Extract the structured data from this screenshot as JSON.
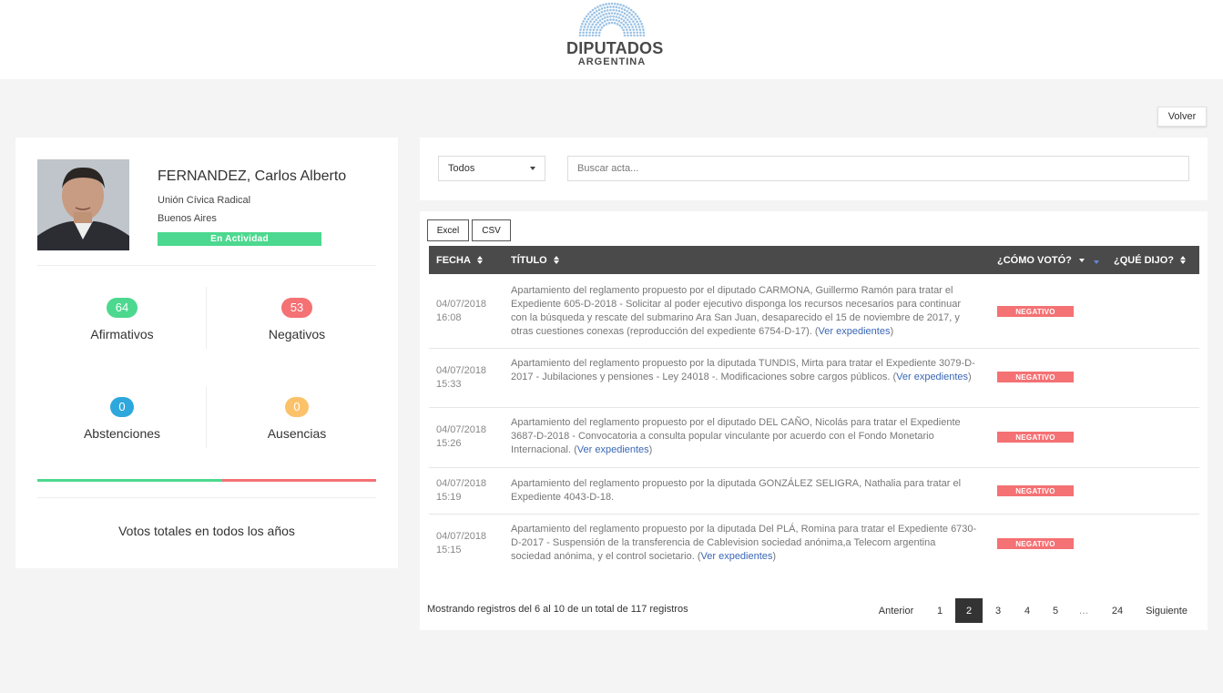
{
  "header": {
    "logo_main": "DIPUTADOS",
    "logo_sub": "ARGENTINA",
    "colors": {
      "logo_blue": "#9cc3e6"
    }
  },
  "back_button": "Volver",
  "profile": {
    "name": "FERNANDEZ, Carlos Alberto",
    "party": "Unión Cívica Radical",
    "district": "Buenos Aires",
    "status": "En Actividad",
    "stats": {
      "afirmativos": {
        "count": "64",
        "label": "Afirmativos",
        "color": "#4cd88f"
      },
      "negativos": {
        "count": "53",
        "label": "Negativos",
        "color": "#f47174"
      },
      "abstenciones": {
        "count": "0",
        "label": "Abstenciones",
        "color": "#2ea8dc"
      },
      "ausencias": {
        "count": "0",
        "label": "Ausencias",
        "color": "#fbc26a"
      }
    },
    "vote_share": {
      "afirmativos": 64,
      "negativos": 53
    },
    "totals_label": "Votos totales en todos los años"
  },
  "filter": {
    "select_value": "Todos",
    "search_placeholder": "Buscar acta..."
  },
  "export": {
    "excel": "Excel",
    "csv": "CSV"
  },
  "table": {
    "columns": {
      "date": "FECHA",
      "title": "TÍTULO",
      "vote": "¿CÓMO VOTÓ?",
      "said": "¿QUÉ DIJO?"
    },
    "link_text": "Ver expedientes",
    "rows": [
      {
        "date": "04/07/2018",
        "time": "16:08",
        "title": "Apartamiento del reglamento propuesto por el diputado CARMONA, Guillermo Ramón para tratar el Expediente 605-D-2018 - Solicitar al poder ejecutivo disponga los recursos necesarios para continuar con la búsqueda y rescate del submarino Ara San Juan, desaparecido el 15 de noviembre de 2017, y otras cuestiones conexas (reproducción del expediente 6754-D-17). ",
        "vote": "NEGATIVO"
      },
      {
        "date": "04/07/2018",
        "time": "15:33",
        "title": "Apartamiento del reglamento propuesto por la diputada TUNDIS, Mirta para tratar el Expediente 3079-D-2017 - Jubilaciones y pensiones - Ley 24018 -. Modificaciones sobre cargos públicos. ",
        "vote": "NEGATIVO"
      },
      {
        "date": "04/07/2018",
        "time": "15:26",
        "title": "Apartamiento del reglamento propuesto por el diputado DEL CAÑO, Nicolás para tratar el Expediente 3687-D-2018 - Convocatoria a consulta popular vinculante por acuerdo con el Fondo Monetario Internacional. ",
        "vote": "NEGATIVO"
      },
      {
        "date": "04/07/2018",
        "time": "15:19",
        "title": "Apartamiento del reglamento propuesto por la diputada GONZÁLEZ SELIGRA, Nathalia para tratar el Expediente 4043-D-18.",
        "vote": "NEGATIVO"
      },
      {
        "date": "04/07/2018",
        "time": "15:15",
        "title": "Apartamiento del reglamento propuesto por la diputada Del PLÁ, Romina para tratar el Expediente 6730-D-2017 - Suspensión de la transferencia de Cablevision sociedad anónima,a Telecom argentina sociedad anónima, y el control societario. ",
        "vote": "NEGATIVO"
      }
    ]
  },
  "pagination": {
    "info": "Mostrando registros del 6 al 10 de un total de 117 registros",
    "prev": "Anterior",
    "next": "Siguiente",
    "pages": [
      "1",
      "2",
      "3",
      "4",
      "5",
      "…",
      "24"
    ],
    "current": "2"
  }
}
